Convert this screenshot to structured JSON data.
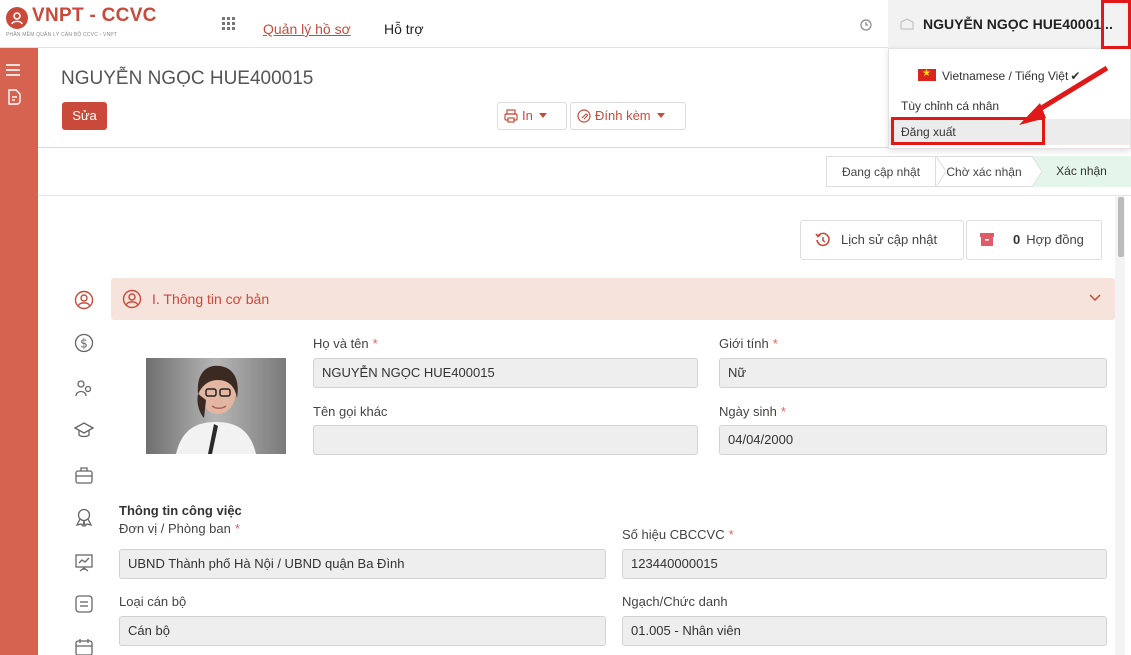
{
  "brand": {
    "title": "VNPT - CCVC",
    "subtitle": "PHẦN MỀM QUẢN LÝ CÁN BỘ CCVC - VNPT"
  },
  "nav": {
    "items": [
      "Quản lý hồ sơ",
      "Hỗ trợ"
    ],
    "active_index": 0
  },
  "user": {
    "name": "NGUYỄN NGỌC HUE40001..."
  },
  "user_menu": {
    "items": [
      {
        "label": "Vietnamese / Tiếng Việt",
        "icon": "vn-flag-icon",
        "checked": true
      },
      {
        "label": "Tùy chỉnh cá nhân"
      },
      {
        "label": "Đăng xuất",
        "highlighted": true
      }
    ]
  },
  "record": {
    "title": "NGUYỄN NGỌC HUE400015",
    "edit_label": "Sửa",
    "print_label": "In",
    "attach_label": "Đính kèm"
  },
  "status_steps": [
    "Đang cập nhật",
    "Chờ xác nhận",
    "Xác nhận"
  ],
  "status_active_index": 2,
  "history_label": "Lịch sử cập nhật",
  "contract": {
    "count": "0",
    "label": "Hợp đồng"
  },
  "section": {
    "title": "I. Thông tin cơ bản"
  },
  "form": {
    "full_name": {
      "label": "Họ và tên",
      "value": "NGUYỄN NGỌC HUE400015"
    },
    "gender": {
      "label": "Giới tính",
      "value": "Nữ"
    },
    "other_name": {
      "label": "Tên gọi khác",
      "value": ""
    },
    "birth_date": {
      "label": "Ngày sinh",
      "value": "04/04/2000"
    }
  },
  "work": {
    "title": "Thông tin công việc",
    "unit": {
      "label": "Đơn vị / Phòng ban",
      "value": "UBND Thành phố Hà Nội / UBND quận Ba Đình"
    },
    "staff_no": {
      "label": "Số hiệu CBCCVC",
      "value": "123440000015"
    },
    "staff_type": {
      "label": "Loại cán bộ",
      "value": "Cán bộ"
    },
    "rank": {
      "label": "Ngạch/Chức danh",
      "value": "01.005 - Nhân viên"
    }
  },
  "colors": {
    "brand": "#c94a3a",
    "sidebar": "#d6634f",
    "section_bg": "#f6e3dc",
    "active_step": "#e4f6ea",
    "annotation": "#e01818"
  }
}
